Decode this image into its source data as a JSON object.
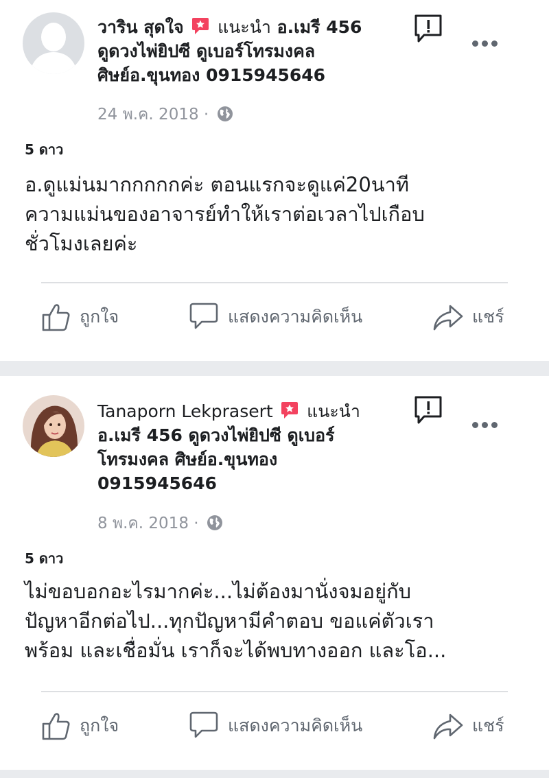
{
  "posts": [
    {
      "author": "วาริน สุดใจ",
      "recommends_label": "แนะนำ",
      "page_name_line1_tail": "อ.เมรี 456",
      "page_name_line2": "ดูดวงไพ่ยิปซี ดูเบอร์โทรมงคล",
      "page_name_line3": "ศิษย์อ.ขุนทอง 0915945646",
      "date": "24 พ.ค. 2018",
      "dot": "·",
      "rating": "5 ดาว",
      "text_lines": [
        "อ.ดูแม่นมากกกกกค่ะ ตอนแรกจะดูแค่20นาที",
        "ความแม่นของอาจารย์ทำให้เราต่อเวลาไปเกือบ",
        "ชั่วโมงเลยค่ะ"
      ],
      "avatar": "default-profile-silhouette"
    },
    {
      "author": "Tanaporn Lekprasert",
      "recommends_label": "แนะนำ",
      "page_name_line2": "อ.เมรี 456 ดูดวงไพ่ยิปซี ดูเบอร์",
      "page_name_line3": "โทรมงคล ศิษย์อ.ขุนทอง",
      "page_name_line4": "0915945646",
      "date": "8 พ.ค. 2018",
      "dot": "·",
      "rating": "5 ดาว",
      "text_lines": [
        "ไม่ขอบอกอะไรมากค่ะ...ไม่ต้องมานั่งจมอยู่กับ",
        "ปัญหาอีกต่อไป...ทุกปัญหามีคำตอบ ขอแค่ตัวเรา",
        "พร้อม และเชื่อมั่น  เราก็จะได้พบทางออก และโอ..."
      ],
      "avatar": "user-photo"
    }
  ],
  "actions": {
    "like": "ถูกใจ",
    "comment": "แสดงความคิดเห็น",
    "share": "แชร์"
  },
  "icons": {
    "recommend": "recommend-star-badge-icon",
    "report": "report-flag-icon",
    "more": "more-options-icon",
    "privacy": "globe-icon",
    "like": "thumbs-up-icon",
    "comment": "comment-bubble-icon",
    "share": "share-arrow-icon"
  },
  "colors": {
    "recommend_badge": "#f3425f",
    "secondary_text": "#90949c",
    "action_text": "#606770",
    "separator": "#e9ebee"
  }
}
